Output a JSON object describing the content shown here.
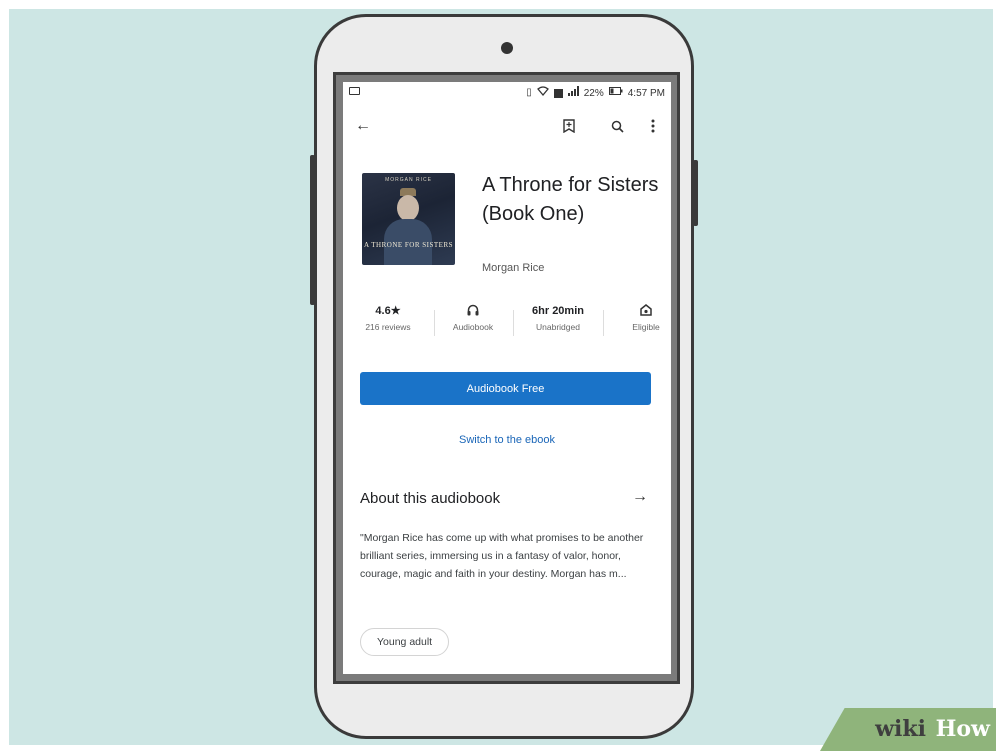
{
  "status_bar": {
    "battery_percent": "22%",
    "time": "4:57 PM",
    "icons": [
      "notification-icon",
      "vibrate-icon",
      "wifi-icon",
      "data-icon",
      "signal-icon",
      "battery-icon"
    ]
  },
  "app_bar": {
    "icons": [
      "back-arrow-icon",
      "bookmark-icon",
      "search-icon",
      "more-vert-icon"
    ]
  },
  "book": {
    "title": "A Throne for Sisters (Book One)",
    "author": "Morgan Rice",
    "cover": {
      "author_text": "MORGAN RICE",
      "title_text": "A THRONE FOR SISTERS"
    }
  },
  "stats": {
    "rating": "4.6★",
    "reviews": "216 reviews",
    "format": "Audiobook",
    "length": "6hr 20min",
    "edition": "Unabridged",
    "eligible": "Eligible"
  },
  "actions": {
    "primary_label": "Audiobook Free",
    "switch_label": "Switch to the ebook"
  },
  "about": {
    "heading": "About this audiobook",
    "description": "\"Morgan Rice has come up with what promises to be another brilliant series, immersing us in a fantasy of valor, honor, courage, magic and faith in your destiny. Morgan has m...",
    "tag": "Young adult"
  },
  "watermark": {
    "part1": "wiki",
    "part2": "How"
  }
}
